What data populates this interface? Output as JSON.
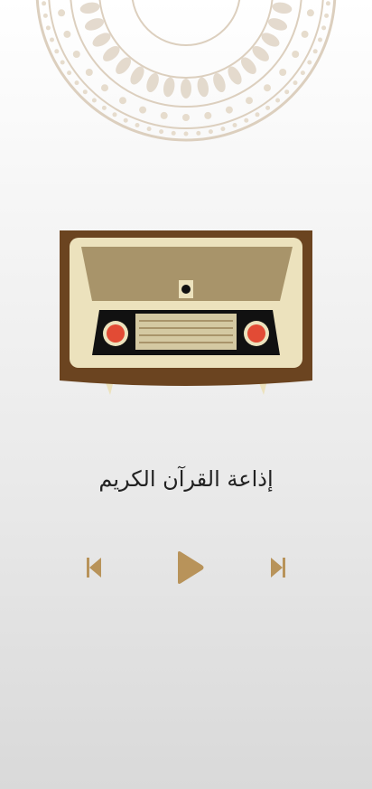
{
  "station": {
    "title": "إذاعة القرآن الكريم"
  },
  "player": {
    "state": "paused",
    "prev_icon": "skip-previous-icon",
    "play_icon": "play-icon",
    "next_icon": "skip-next-icon"
  },
  "theme": {
    "accent": "#b8935a",
    "ornament": "#dccfbe",
    "radio_body": "#6b4420",
    "radio_face": "#ece2bd",
    "speaker_panel": "#a8946a",
    "dial_panel": "#111111",
    "knob": "#e24b35",
    "text": "#222222"
  }
}
